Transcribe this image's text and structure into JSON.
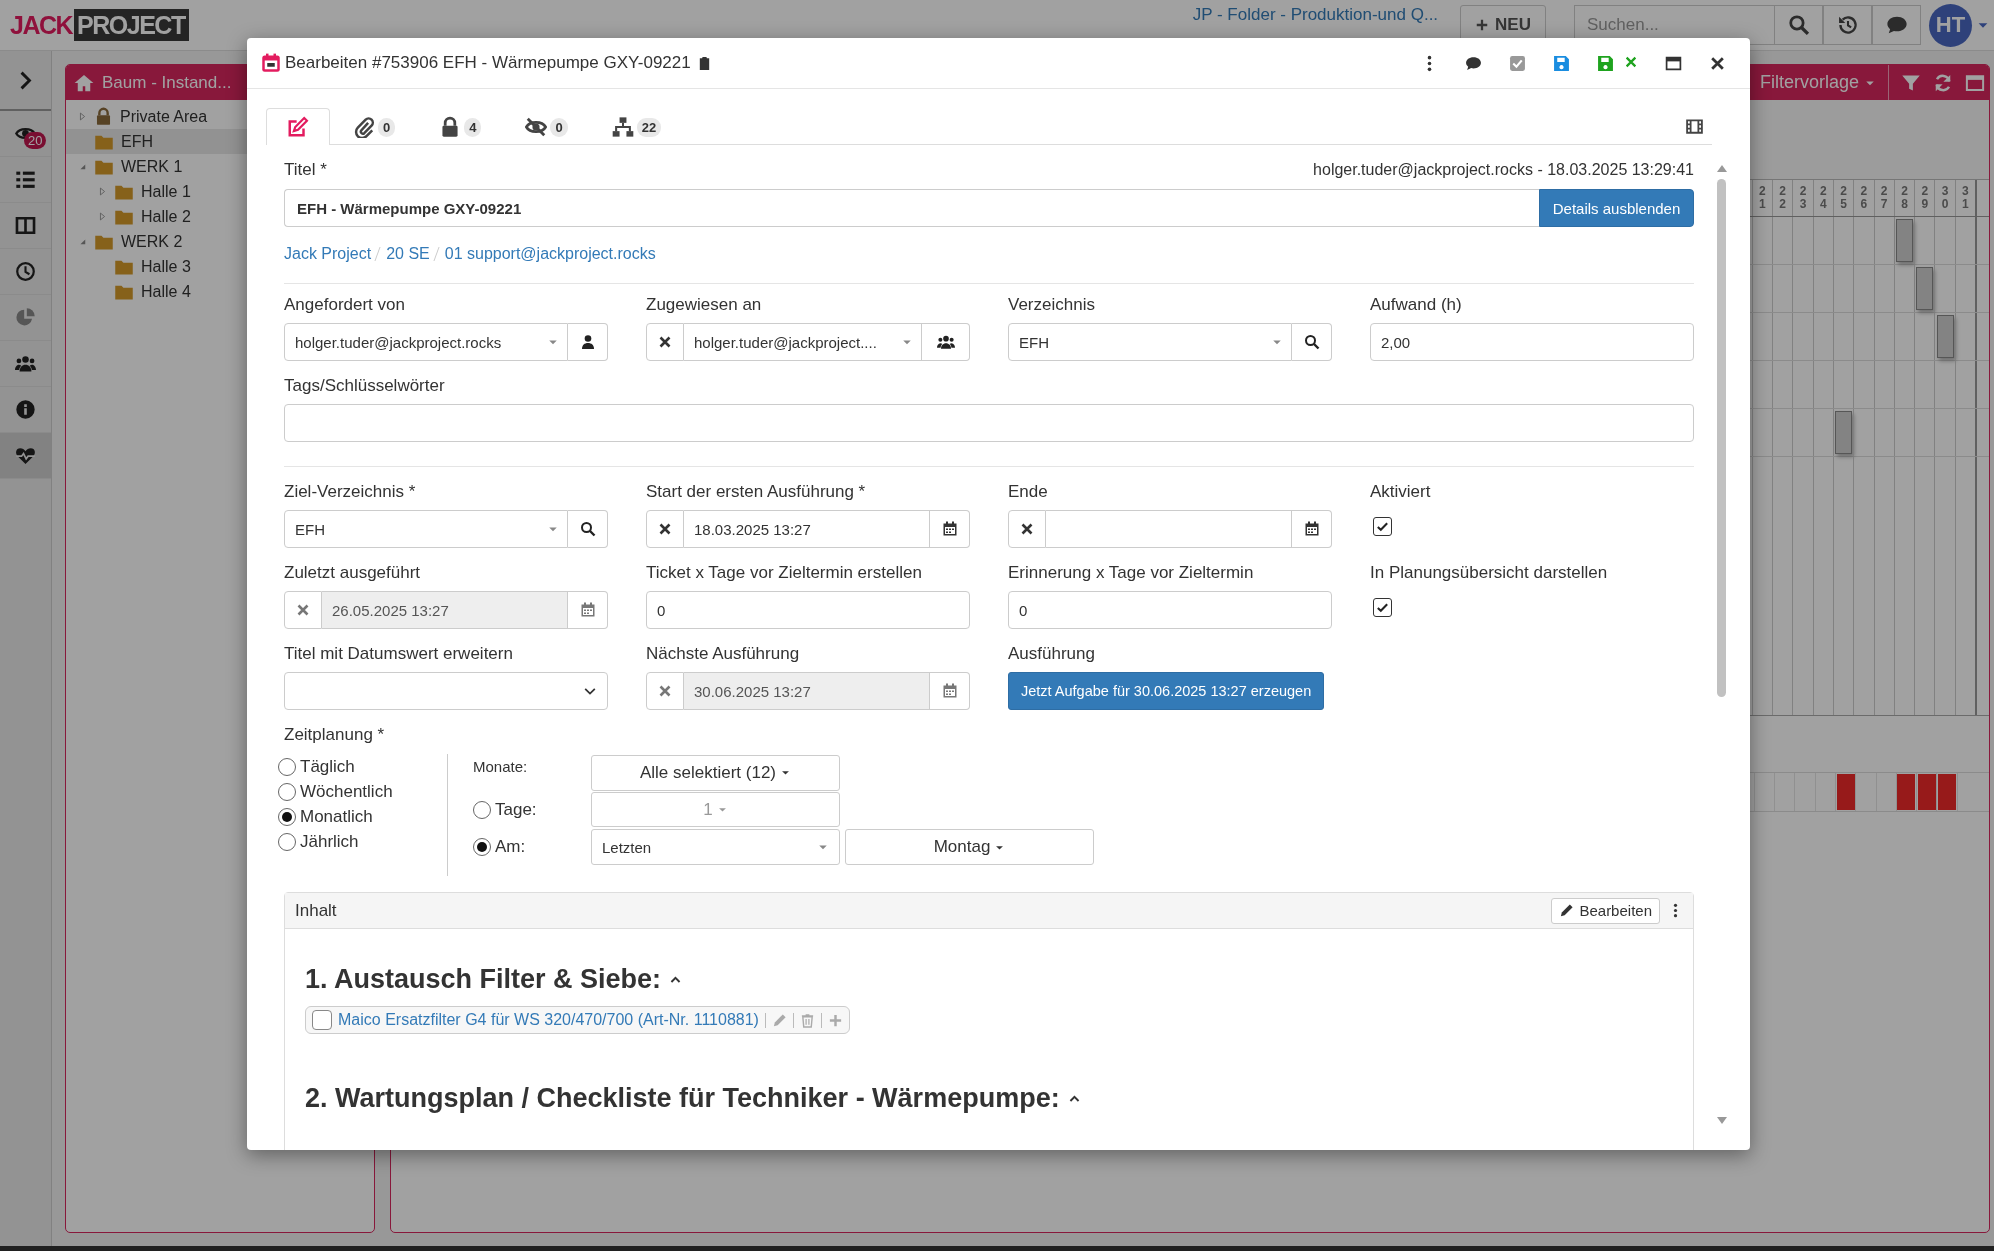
{
  "topbar": {
    "logo": [
      "JACK",
      "PROJECT"
    ],
    "folder_link": "JP - Folder - Produktion-und Q...",
    "new_button": "NEU",
    "search": {
      "placeholder": "Suchen..."
    },
    "avatar": "HT"
  },
  "sidebar": {
    "items": [
      {
        "kind": "eye",
        "badge": "20",
        "selected": false
      },
      {
        "kind": "list",
        "selected": false
      },
      {
        "kind": "columns",
        "selected": false
      },
      {
        "kind": "clock",
        "selected": false
      },
      {
        "kind": "pie",
        "selected": false
      },
      {
        "kind": "users",
        "selected": false
      },
      {
        "kind": "info",
        "selected": false
      },
      {
        "kind": "heartbeat",
        "selected": true
      }
    ]
  },
  "tree_panel": {
    "title": "Baum - Instand...",
    "nodes": [
      {
        "label": "Private Area",
        "kind": "lock",
        "expanded": false,
        "selected": false
      },
      {
        "label": "EFH",
        "kind": "folder",
        "selected": true
      },
      {
        "label": "WERK 1",
        "kind": "folder",
        "expanded": true,
        "selected": false,
        "children": [
          {
            "label": "Halle 1",
            "kind": "folder",
            "expanded": false,
            "selected": false
          },
          {
            "label": "Halle 2",
            "kind": "folder",
            "expanded": false,
            "selected": false
          }
        ]
      },
      {
        "label": "WERK 2",
        "kind": "folder",
        "expanded": true,
        "selected": false,
        "children": [
          {
            "label": "Halle 3",
            "kind": "folder",
            "selected": false
          },
          {
            "label": "Halle 4",
            "kind": "folder",
            "selected": false
          }
        ]
      }
    ]
  },
  "plan_panel": {
    "filter_label": "Filtervorlage",
    "days": [
      "21",
      "22",
      "23",
      "24",
      "25",
      "26",
      "27",
      "28",
      "29",
      "30",
      "31"
    ],
    "rows": [
      {
        "bars": [
          false,
          false,
          false,
          false,
          false,
          false,
          false,
          true,
          false,
          false,
          false
        ]
      },
      {
        "bars": [
          false,
          false,
          false,
          false,
          false,
          false,
          false,
          false,
          true,
          false,
          false
        ]
      },
      {
        "bars": [
          false,
          false,
          false,
          false,
          false,
          false,
          false,
          false,
          false,
          true,
          false
        ]
      },
      {
        "bars": [
          false,
          false,
          false,
          false,
          false,
          false,
          false,
          false,
          false,
          false,
          false
        ]
      },
      {
        "bars": [
          false,
          false,
          false,
          false,
          true,
          false,
          false,
          false,
          false,
          false,
          false
        ]
      }
    ],
    "milestones": {
      "bars": [
        false,
        false,
        false,
        false,
        true,
        false,
        false,
        true,
        true,
        true,
        false
      ]
    }
  },
  "dialog": {
    "title": "Bearbeiten #753906 EFH - Wärmepumpe GXY-09221",
    "tabs": [
      {
        "kind": "edit",
        "selected": true
      },
      {
        "kind": "attachments",
        "count": "0",
        "selected": false
      },
      {
        "kind": "permissions",
        "count": "4",
        "selected": false
      },
      {
        "kind": "hidden",
        "count": "0",
        "selected": false
      },
      {
        "kind": "structure",
        "count": "22",
        "selected": false
      }
    ],
    "title_field": {
      "label": "Titel *",
      "value": "EFH - Wärmepumpe GXY-09221"
    },
    "meta": "holger.tuder@jackproject.rocks - 18.03.2025 13:29:41",
    "details_button": "Details ausblenden",
    "breadcrumb": [
      "Jack Project",
      "20 SE",
      "01 support@jackproject.rocks"
    ],
    "fields": [
      {
        "kind": "select",
        "label": "Angefordert von",
        "value": "holger.tuder@jackproject.rocks",
        "clearable": false,
        "addon": {
          "kind": "user"
        }
      },
      {
        "kind": "select",
        "label": "Zugewiesen an",
        "value": "holger.tuder@jackproject....",
        "clearable": true,
        "addon": {
          "kind": "users"
        }
      },
      {
        "kind": "select",
        "label": "Verzeichnis",
        "value": "EFH",
        "clearable": false,
        "addon": {
          "kind": "search"
        }
      },
      {
        "kind": "text",
        "label": "Aufwand (h)",
        "value": "2,00"
      }
    ],
    "tags": {
      "label": "Tags/Schlüsselwörter"
    },
    "schedule_fields": [
      {
        "kind": "select",
        "label": "Ziel-Verzeichnis *",
        "value": "EFH",
        "clearable": false,
        "addon": {
          "kind": "search"
        }
      },
      {
        "kind": "date",
        "label": "Start der ersten Ausführung *",
        "value": "18.03.2025 13:27",
        "clearable": true,
        "disabled": false
      },
      {
        "kind": "date",
        "label": "Ende",
        "clearable": true,
        "disabled": false
      },
      {
        "kind": "checkbox",
        "label": "Aktiviert",
        "checked": true
      },
      {
        "kind": "date",
        "label": "Zuletzt ausgeführt",
        "value": "26.05.2025 13:27",
        "clearable": true,
        "disabled": true
      },
      {
        "kind": "text",
        "label": "Ticket x Tage vor Zieltermin erstellen",
        "value": "0"
      },
      {
        "kind": "text",
        "label": "Erinnerung x Tage vor Zieltermin",
        "value": "0"
      },
      {
        "kind": "checkbox",
        "label": "In Planungsübersicht darstellen",
        "checked": true
      },
      {
        "kind": "native-select",
        "label": "Titel mit Datumswert erweitern"
      },
      {
        "kind": "date",
        "label": "Nächste Ausführung",
        "value": "30.06.2025 13:27",
        "clearable": true,
        "disabled": true
      },
      {
        "kind": "action",
        "label": "Ausführung",
        "button": "Jetzt Aufgabe für 30.06.2025 13:27 erzeugen"
      }
    ],
    "planning": {
      "label": "Zeitplanung *",
      "options": [
        {
          "label": "Täglich",
          "selected": false
        },
        {
          "label": "Wöchentlich",
          "selected": false
        },
        {
          "label": "Monatlich",
          "selected": true
        },
        {
          "label": "Jährlich",
          "selected": false
        }
      ],
      "months_label": "Monate:",
      "months_value": "Alle selektiert (12)",
      "day_modes": [
        {
          "label": "Tage:",
          "selected": false,
          "value": "1"
        },
        {
          "label": "Am:",
          "selected": true,
          "value": "Letzten",
          "weekday": "Montag"
        }
      ]
    },
    "content": {
      "title": "Inhalt",
      "edit_button": "Bearbeiten",
      "sections": [
        {
          "heading": "1. Austausch Filter & Siebe:",
          "expanded": true,
          "items": [
            {
              "label": "Maico Ersatzfilter G4 für WS 320/470/700 (Art-Nr. 1110881)",
              "checked": false
            }
          ]
        },
        {
          "heading": "2. Wartungsplan / Checkliste für Techniker - Wärmepumpe:",
          "expanded": true
        }
      ]
    }
  }
}
